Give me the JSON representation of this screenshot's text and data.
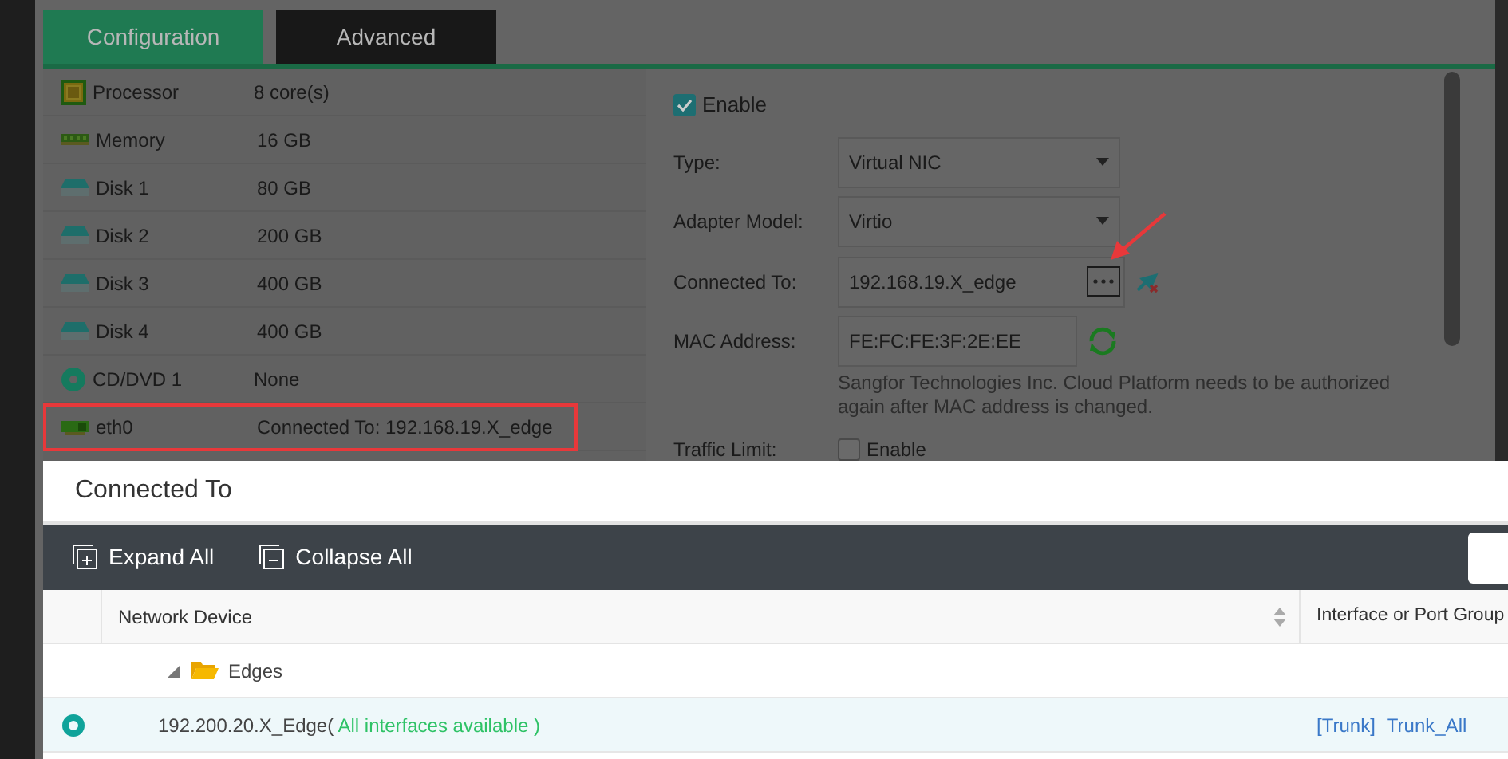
{
  "tabs": [
    {
      "label": "Configuration",
      "selected": true
    },
    {
      "label": "Advanced",
      "selected": false
    }
  ],
  "hardware": [
    {
      "kind": "processor",
      "name": "Processor",
      "value": "8 core(s)",
      "highlighted": false
    },
    {
      "kind": "memory",
      "name": "Memory",
      "value": "16 GB",
      "highlighted": false
    },
    {
      "kind": "disk",
      "name": "Disk 1",
      "value": "80 GB",
      "highlighted": false
    },
    {
      "kind": "disk",
      "name": "Disk 2",
      "value": "200 GB",
      "highlighted": false
    },
    {
      "kind": "disk",
      "name": "Disk 3",
      "value": "400 GB",
      "highlighted": false
    },
    {
      "kind": "disk",
      "name": "Disk 4",
      "value": "400 GB",
      "highlighted": false
    },
    {
      "kind": "cdrom",
      "name": "CD/DVD 1",
      "value": "None",
      "highlighted": false
    },
    {
      "kind": "nic",
      "name": "eth0",
      "value": "Connected To: 192.168.19.X_edge",
      "highlighted": true
    }
  ],
  "nic_form": {
    "enable": {
      "label": "Enable",
      "checked": true
    },
    "fields": [
      {
        "kind": "select",
        "label": "Type:",
        "value": "Virtual NIC"
      },
      {
        "kind": "select",
        "label": "Adapter Model:",
        "value": "Virtio"
      },
      {
        "kind": "picker",
        "label": "Connected To:",
        "value": "192.168.19.X_edge"
      },
      {
        "kind": "mac",
        "label": "MAC Address:",
        "value": "FE:FC:FE:3F:2E:EE",
        "note": "Sangfor Technologies Inc. Cloud Platform needs to be authorized again after MAC address is changed."
      }
    ],
    "traffic_limit": {
      "label": "Traffic Limit:",
      "checkbox_label": "Enable",
      "checked": false
    }
  },
  "modal": {
    "title": "Connected To",
    "toolbar": [
      {
        "kind": "expand",
        "label": "Expand All"
      },
      {
        "kind": "collapse",
        "label": "Collapse All"
      }
    ],
    "columns": [
      "Network Device",
      "Interface or Port Group"
    ],
    "tree": [
      {
        "label": "Edges",
        "expanded": true,
        "children": [
          {
            "name": "192.200.20.X_Edge(",
            "status": " All interfaces available )",
            "selected": true,
            "port_type": "[Trunk]",
            "port": "Trunk_All"
          }
        ]
      }
    ]
  }
}
